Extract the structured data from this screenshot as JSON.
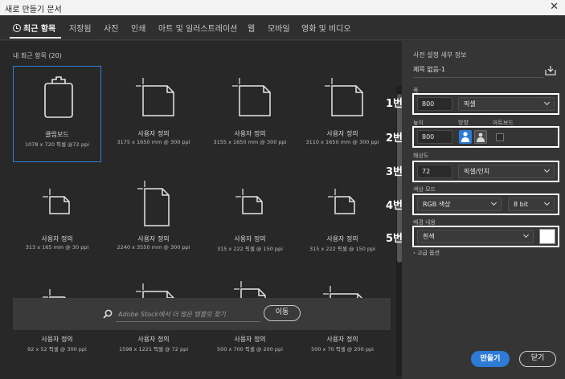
{
  "window": {
    "title": "새로 만들기 문서",
    "close_glyph": "✕"
  },
  "tabs": [
    {
      "label": "최근 항목",
      "active": true
    },
    {
      "label": "저장됨"
    },
    {
      "label": "사진"
    },
    {
      "label": "인쇄"
    },
    {
      "label": "아트 및 일러스트레이션"
    },
    {
      "label": "웹"
    },
    {
      "label": "모바일"
    },
    {
      "label": "영화 및 비디오"
    }
  ],
  "recent": {
    "title": "내 최근 항목",
    "count": "(20)",
    "items": [
      {
        "name": "클립보드",
        "dims": "1078 x 720 픽셀 @72 ppi",
        "icon": "clipboard-icon",
        "selected": true
      },
      {
        "name": "사용자 정의",
        "dims": "3175 x 1650 mm @ 300 ppi",
        "icon": "document-landscape-icon"
      },
      {
        "name": "사용자 정의",
        "dims": "3155 x 1650 mm @ 300 ppi",
        "icon": "document-landscape-icon"
      },
      {
        "name": "사용자 정의",
        "dims": "3110 x 1650 mm @ 300 ppi",
        "icon": "document-landscape-icon"
      },
      {
        "name": "사용자 정의",
        "dims": "313 x 165 mm @ 30 ppi",
        "icon": "document-small-icon"
      },
      {
        "name": "사용자 정의",
        "dims": "2240 x 3550 mm @ 300 ppi",
        "icon": "document-portrait-icon"
      },
      {
        "name": "사용자 정의",
        "dims": "315 x 222 픽셀 @ 150 ppi",
        "icon": "document-small-icon"
      },
      {
        "name": "사용자 정의",
        "dims": "315 x 222 픽셀 @ 150 ppi",
        "icon": "document-small-icon"
      },
      {
        "name": "사용자 정의",
        "dims": "92 x 52 픽셀 @ 300 ppi",
        "icon": "document-small-icon"
      },
      {
        "name": "사용자 정의",
        "dims": "1598 x 1221 픽셀 @ 72 ppi",
        "icon": "document-landscape-icon"
      },
      {
        "name": "사용자 정의",
        "dims": "500 x 700 픽셀 @ 200 ppi",
        "icon": "document-portrait-icon"
      },
      {
        "name": "사용자 정의",
        "dims": "500 x 70 픽셀 @ 200 ppi",
        "icon": "document-wide-icon"
      }
    ]
  },
  "search": {
    "placeholder": "Adobe Stock에서 더 많은 템플릿 찾기",
    "go_label": "이동"
  },
  "preset": {
    "section_title": "사전 설정 세부 정보",
    "doc_name": "제목 없음-1",
    "width": {
      "label": "폭",
      "value": "800",
      "unit": "픽셀",
      "callout": "1번"
    },
    "height": {
      "label": "높이",
      "value": "800",
      "callout": "2번"
    },
    "orientation": {
      "label": "방향",
      "selected": "portrait"
    },
    "artboard": {
      "label": "아트보드",
      "checked": false
    },
    "resolution": {
      "label": "해상도",
      "value": "72",
      "unit": "픽셀/인치",
      "callout": "3번"
    },
    "color_mode": {
      "label": "색상 모드",
      "value": "RGB 색상",
      "bits": "8 bit",
      "callout": "4번"
    },
    "background": {
      "label": "배경 내용",
      "value": "흰색",
      "swatch_color": "#ffffff",
      "callout": "5번"
    },
    "advanced_label": "고급 옵션",
    "create_label": "만들기",
    "close_label": "닫기"
  },
  "colors": {
    "accent": "#2d7bd6",
    "highlight_box": "#ffffff"
  }
}
